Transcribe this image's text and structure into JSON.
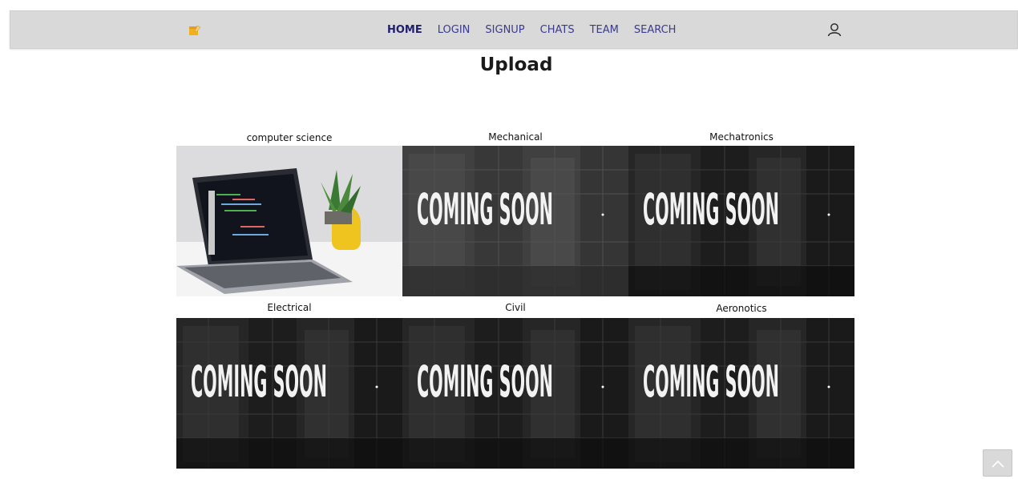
{
  "nav": {
    "logo_icon": "sticky-note-icon",
    "links": [
      {
        "label": "HOME",
        "active": true
      },
      {
        "label": "LOGIN",
        "active": false
      },
      {
        "label": "SIGNUP",
        "active": false
      },
      {
        "label": "CHATS",
        "active": false
      },
      {
        "label": "TEAM",
        "active": false
      },
      {
        "label": "SEARCH",
        "active": false
      }
    ],
    "user_icon": "user-icon"
  },
  "page": {
    "title": "Upload"
  },
  "departments": [
    {
      "label": "computer science",
      "image": "laptop-code-photo"
    },
    {
      "label": "Mechanical",
      "image": "coming-soon-photo",
      "image_text": "COMING SOON"
    },
    {
      "label": "Mechatronics",
      "image": "coming-soon-photo",
      "image_text": "COMING SOON"
    },
    {
      "label": "Electrical",
      "image": "coming-soon-photo",
      "image_text": "COMING SOON"
    },
    {
      "label": "Civil",
      "image": "coming-soon-photo",
      "image_text": "COMING SOON"
    },
    {
      "label": "Aeronotics",
      "image": "coming-soon-photo",
      "image_text": "COMING SOON"
    }
  ],
  "scroll_top": {
    "icon": "chevron-up-icon"
  },
  "colors": {
    "navbar_bg": "#d9d9d9",
    "nav_link": "#3b3b8c",
    "nav_active": "#1f1f6b"
  }
}
